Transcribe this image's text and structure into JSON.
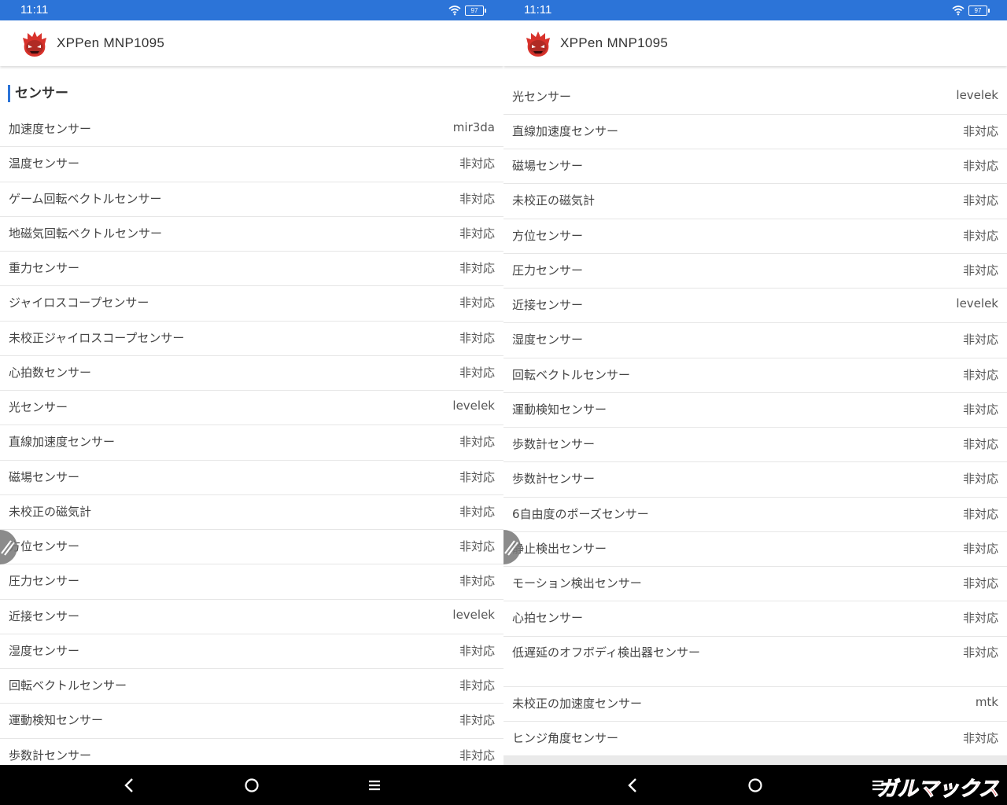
{
  "status_bar": {
    "time": "11:11",
    "battery": "97"
  },
  "app_title": "XPPen MNP1095",
  "left": {
    "section_title": "センサー",
    "rows": [
      {
        "label": "加速度センサー",
        "value": "mir3da"
      },
      {
        "label": "温度センサー",
        "value": "非対応"
      },
      {
        "label": "ゲーム回転ベクトルセンサー",
        "value": "非対応"
      },
      {
        "label": "地磁気回転ベクトルセンサー",
        "value": "非対応"
      },
      {
        "label": "重力センサー",
        "value": "非対応"
      },
      {
        "label": "ジャイロスコープセンサー",
        "value": "非対応"
      },
      {
        "label": "未校正ジャイロスコープセンサー",
        "value": "非対応"
      },
      {
        "label": "心拍数センサー",
        "value": "非対応"
      },
      {
        "label": "光センサー",
        "value": "levelek"
      },
      {
        "label": "直線加速度センサー",
        "value": "非対応"
      },
      {
        "label": "磁場センサー",
        "value": "非対応"
      },
      {
        "label": "未校正の磁気計",
        "value": "非対応"
      },
      {
        "label": "方位センサー",
        "value": "非対応"
      },
      {
        "label": "圧力センサー",
        "value": "非対応"
      },
      {
        "label": "近接センサー",
        "value": "levelek"
      },
      {
        "label": "湿度センサー",
        "value": "非対応"
      },
      {
        "label": "回転ベクトルセンサー",
        "value": "非対応"
      },
      {
        "label": "運動検知センサー",
        "value": "非対応"
      },
      {
        "label": "歩数計センサー",
        "value": "非対応"
      }
    ]
  },
  "right": {
    "rows": [
      {
        "label": "光センサー",
        "value": "levelek"
      },
      {
        "label": "直線加速度センサー",
        "value": "非対応"
      },
      {
        "label": "磁場センサー",
        "value": "非対応"
      },
      {
        "label": "未校正の磁気計",
        "value": "非対応"
      },
      {
        "label": "方位センサー",
        "value": "非対応"
      },
      {
        "label": "圧力センサー",
        "value": "非対応"
      },
      {
        "label": "近接センサー",
        "value": "levelek"
      },
      {
        "label": "湿度センサー",
        "value": "非対応"
      },
      {
        "label": "回転ベクトルセンサー",
        "value": "非対応"
      },
      {
        "label": "運動検知センサー",
        "value": "非対応"
      },
      {
        "label": "歩数計センサー",
        "value": "非対応"
      },
      {
        "label": "歩数計センサー",
        "value": "非対応"
      },
      {
        "label": "6自由度のポーズセンサー",
        "value": "非対応"
      },
      {
        "label": "静止検出センサー",
        "value": "非対応"
      },
      {
        "label": "モーション検出センサー",
        "value": "非対応"
      },
      {
        "label": "心拍センサー",
        "value": "非対応"
      },
      {
        "label": "低遅延のオフボディ検出器センサー",
        "value": "非対応"
      },
      {
        "label": "未校正の加速度センサー",
        "value": "mtk"
      },
      {
        "label": "ヒンジ角度センサー",
        "value": "非対応"
      }
    ]
  },
  "icons": {
    "logo": "antutu-logo-icon",
    "wifi": "wifi-icon",
    "battery": "battery-icon",
    "float": "floating-edit-icon",
    "back": "back-icon",
    "home": "home-icon",
    "menu": "menu-icon"
  },
  "watermark": "ガルマックス",
  "colors": {
    "status_bar": "#2c74d8",
    "accent": "#2c74d8",
    "logo_red": "#d8322b",
    "watermark_red": "#e0161b"
  }
}
